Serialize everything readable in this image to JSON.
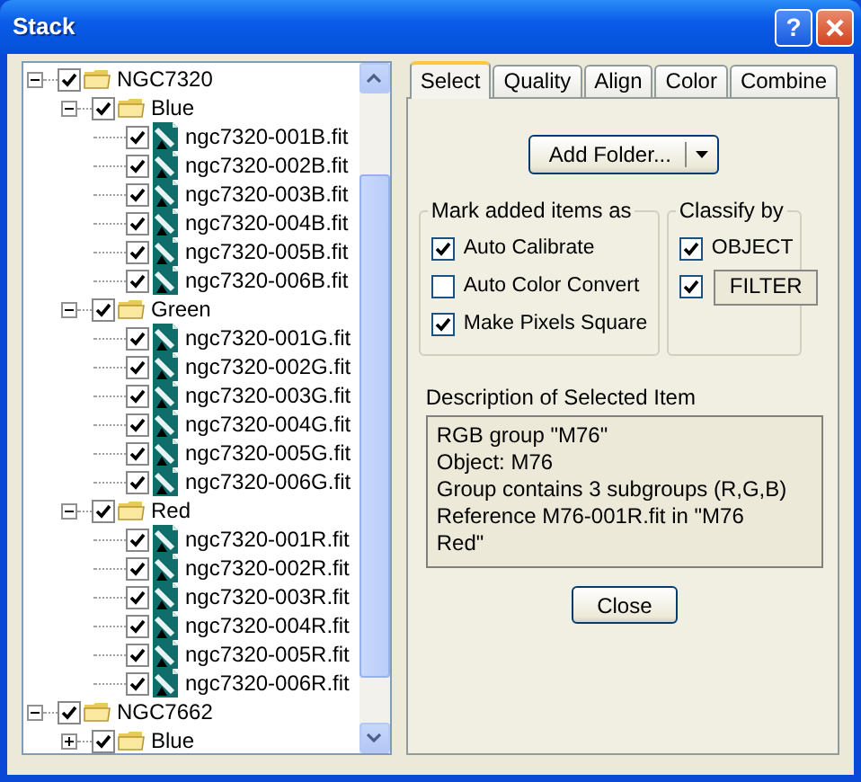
{
  "window": {
    "title": "Stack"
  },
  "help_button": "?",
  "tree": [
    {
      "label": "NGC7320",
      "kind": "folder",
      "checked": true,
      "expanded": true,
      "children": [
        {
          "label": "Blue",
          "kind": "folder",
          "checked": true,
          "expanded": true,
          "children": [
            {
              "label": "ngc7320-001B.fit",
              "kind": "file",
              "checked": true
            },
            {
              "label": "ngc7320-002B.fit",
              "kind": "file",
              "checked": true
            },
            {
              "label": "ngc7320-003B.fit",
              "kind": "file",
              "checked": true
            },
            {
              "label": "ngc7320-004B.fit",
              "kind": "file",
              "checked": true
            },
            {
              "label": "ngc7320-005B.fit",
              "kind": "file",
              "checked": true
            },
            {
              "label": "ngc7320-006B.fit",
              "kind": "file",
              "checked": true
            }
          ]
        },
        {
          "label": "Green",
          "kind": "folder",
          "checked": true,
          "expanded": true,
          "children": [
            {
              "label": "ngc7320-001G.fit",
              "kind": "file",
              "checked": true
            },
            {
              "label": "ngc7320-002G.fit",
              "kind": "file",
              "checked": true
            },
            {
              "label": "ngc7320-003G.fit",
              "kind": "file",
              "checked": true
            },
            {
              "label": "ngc7320-004G.fit",
              "kind": "file",
              "checked": true
            },
            {
              "label": "ngc7320-005G.fit",
              "kind": "file",
              "checked": true
            },
            {
              "label": "ngc7320-006G.fit",
              "kind": "file",
              "checked": true
            }
          ]
        },
        {
          "label": "Red",
          "kind": "folder",
          "checked": true,
          "expanded": true,
          "children": [
            {
              "label": "ngc7320-001R.fit",
              "kind": "file",
              "checked": true
            },
            {
              "label": "ngc7320-002R.fit",
              "kind": "file",
              "checked": true
            },
            {
              "label": "ngc7320-003R.fit",
              "kind": "file",
              "checked": true
            },
            {
              "label": "ngc7320-004R.fit",
              "kind": "file",
              "checked": true
            },
            {
              "label": "ngc7320-005R.fit",
              "kind": "file",
              "checked": true
            },
            {
              "label": "ngc7320-006R.fit",
              "kind": "file",
              "checked": true
            }
          ]
        }
      ]
    },
    {
      "label": "NGC7662",
      "kind": "folder",
      "checked": true,
      "expanded": true,
      "children": [
        {
          "label": "Blue",
          "kind": "folder",
          "checked": true,
          "expanded": false
        }
      ]
    }
  ],
  "tabs": [
    {
      "label": "Select",
      "selected": true
    },
    {
      "label": "Quality",
      "selected": false
    },
    {
      "label": "Align",
      "selected": false
    },
    {
      "label": "Color",
      "selected": false
    },
    {
      "label": "Combine",
      "selected": false
    }
  ],
  "add_folder_button": "Add Folder...",
  "mark_group": {
    "title": "Mark added items as",
    "options": [
      {
        "label": "Auto Calibrate",
        "checked": true
      },
      {
        "label": "Auto Color Convert",
        "checked": false
      },
      {
        "label": "Make Pixels Square",
        "checked": true
      }
    ]
  },
  "classify_group": {
    "title": "Classify by",
    "options": [
      {
        "label": "OBJECT",
        "checked": true,
        "kind": "label"
      },
      {
        "label": "FILTER",
        "checked": true,
        "kind": "button"
      }
    ]
  },
  "description": {
    "label": "Description of Selected Item",
    "lines": [
      "RGB group \"M76\"",
      "Object: M76",
      "Group contains 3 subgroups (R,G,B)",
      "Reference M76-001R.fit in \"M76",
      "Red\""
    ]
  },
  "close_button": "Close"
}
